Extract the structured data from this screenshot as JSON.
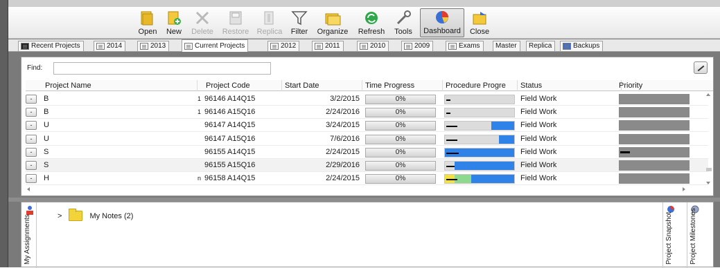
{
  "toolbar": {
    "buttons": [
      {
        "label": "Open",
        "icon": "folder-open-icon",
        "enabled": true
      },
      {
        "label": "New",
        "icon": "new-document-icon",
        "enabled": true
      },
      {
        "label": "Delete",
        "icon": "delete-x-icon",
        "enabled": false
      },
      {
        "label": "Restore",
        "icon": "restore-icon",
        "enabled": false
      },
      {
        "label": "Replica",
        "icon": "replica-icon",
        "enabled": false
      },
      {
        "label": "Filter",
        "icon": "funnel-icon",
        "enabled": true
      },
      {
        "label": "Organize",
        "icon": "folders-icon",
        "enabled": true
      },
      {
        "label": "Refresh",
        "icon": "refresh-icon",
        "enabled": true
      },
      {
        "label": "Tools",
        "icon": "wrench-icon",
        "enabled": true
      },
      {
        "label": "Dashboard",
        "icon": "pie-chart-icon",
        "enabled": true,
        "active": true
      },
      {
        "label": "Close",
        "icon": "close-folder-icon",
        "enabled": true
      }
    ]
  },
  "tabs": [
    {
      "label": "Recent Projects",
      "icon": "recent-icon"
    },
    {
      "label": "2014",
      "icon": "list-icon"
    },
    {
      "label": "2013",
      "icon": "list-icon"
    },
    {
      "label": "Current Projects",
      "icon": "list-icon",
      "active": true
    },
    {
      "label": "2012",
      "icon": "list-icon"
    },
    {
      "label": "2011",
      "icon": "list-icon"
    },
    {
      "label": "2010",
      "icon": "list-icon"
    },
    {
      "label": "2009",
      "icon": "list-icon"
    },
    {
      "label": "Exams",
      "icon": "list-icon"
    },
    {
      "label": "Master",
      "icon": ""
    },
    {
      "label": "Replica",
      "icon": ""
    },
    {
      "label": "Backups",
      "icon": "backup-icon"
    }
  ],
  "find": {
    "label": "Find:",
    "value": ""
  },
  "grid": {
    "columns": [
      "Project Name",
      "Project Code",
      "Start Date",
      "Time Progress",
      "Procedure Progre",
      "Status",
      "Priority"
    ],
    "rows": [
      {
        "name": "B",
        "suffix": "1",
        "code": "96146 A14Q15",
        "start": "3/2/2015",
        "time_progress": "0%",
        "proc_blue": 0,
        "proc_mark": 6,
        "proc_yellow": false,
        "proc_green": false,
        "status": "Field Work",
        "priority_mark": false
      },
      {
        "name": "B",
        "suffix": "1",
        "code": "96146 A15Q16",
        "start": "2/24/2016",
        "time_progress": "0%",
        "proc_blue": 0,
        "proc_mark": 6,
        "proc_yellow": false,
        "proc_green": false,
        "status": "Field Work",
        "priority_mark": false
      },
      {
        "name": "U",
        "suffix": "",
        "code": "96147 A14Q15",
        "start": "3/24/2015",
        "time_progress": "0%",
        "proc_blue": 0.33,
        "proc_mark": 16,
        "proc_yellow": false,
        "proc_green": false,
        "status": "Field Work",
        "priority_mark": false
      },
      {
        "name": "U",
        "suffix": "",
        "code": "96147 A15Q16",
        "start": "7/6/2016",
        "time_progress": "0%",
        "proc_blue": 0.22,
        "proc_mark": 16,
        "proc_yellow": false,
        "proc_green": false,
        "status": "Field Work",
        "priority_mark": false
      },
      {
        "name": "S",
        "suffix": "",
        "code": "96155 A14Q15",
        "start": "2/24/2015",
        "time_progress": "0%",
        "proc_blue": 1.0,
        "proc_mark": 18,
        "proc_yellow": false,
        "proc_green": false,
        "status": "Field Work",
        "priority_mark": true
      },
      {
        "name": "S",
        "suffix": "",
        "code": "96155 A15Q16",
        "start": "2/29/2016",
        "time_progress": "0%",
        "proc_blue": 0.86,
        "proc_mark": 12,
        "proc_yellow": false,
        "proc_green": false,
        "status": "Field Work",
        "priority_mark": false
      },
      {
        "name": "H",
        "suffix": "n",
        "code": "96158 A14Q15",
        "start": "2/24/2015",
        "time_progress": "0%",
        "proc_blue": 0.62,
        "proc_mark": 16,
        "proc_yellow": true,
        "proc_green": true,
        "status": "Field Work",
        "priority_mark": false
      }
    ]
  },
  "bottom": {
    "left_tab": "My Assignments",
    "notes_label": "My Notes (2)",
    "right_tabs": [
      "Project Snapshot",
      "Project Milestones"
    ]
  },
  "colors": {
    "progress_blue": "#2f82e8",
    "priority_gray": "#8a8a8a",
    "progress_green": "#8fd98f",
    "progress_yellow": "#f4e23a"
  }
}
